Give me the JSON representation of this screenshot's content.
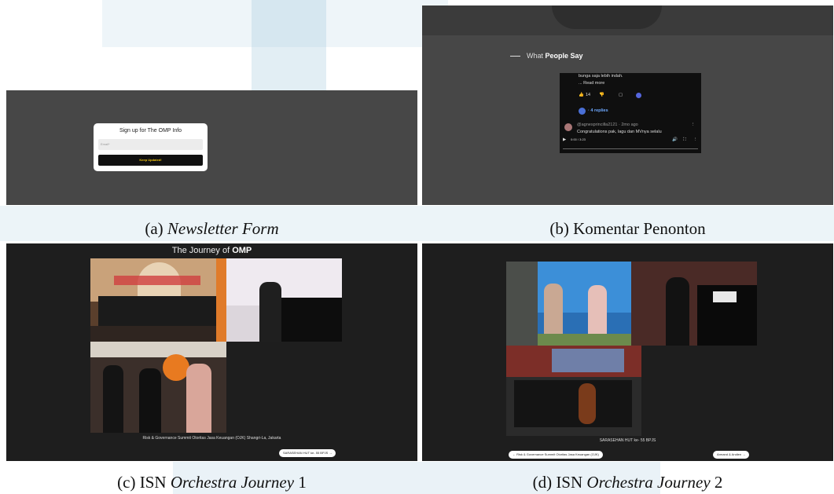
{
  "captions": {
    "a_label": "(a)",
    "a_title": "Newsletter Form",
    "b_label": "(b)",
    "b_title": "Komentar Penonton",
    "c_label": "(c) ISN",
    "c_title": "Orchestra Journey",
    "c_num": "1",
    "d_label": "(d) ISN",
    "d_title": "Orchestra Journey",
    "d_num": "2"
  },
  "newsletter": {
    "title": "Sign up for The OMP Info",
    "email_placeholder": "Email*",
    "submit_label": "Keep Updated!"
  },
  "comments": {
    "section_prefix": "What",
    "section_bold": "People Say",
    "snippet_line": "bunga saja lebih indah.",
    "read_more": "... Read more",
    "likes": "14",
    "replies": "· 4 replies",
    "author_line": "@agnesprincilla2121 · 2mo ago",
    "comment_text": "Congratulations pak, lagu dan MVnya selalu",
    "video_time": "0:00 / 3:23"
  },
  "journey1": {
    "title_prefix": "The Journey of",
    "title_bold": "OMP",
    "photo_caption": "Risk & Governance Summit Otoritas Jasa Keuangan (OJK) Shangri-La, Jakarta",
    "next_button": "SARASEHAN HUT ke- 55 BPJS →"
  },
  "journey2": {
    "photo_caption": "SARASEHAN HUT ke- 55 BPJS",
    "prev_button": "← Risk & Governance Summit Otoritas Jasa Keuangan (OJK)",
    "next_button": "Armand & Andien →"
  }
}
